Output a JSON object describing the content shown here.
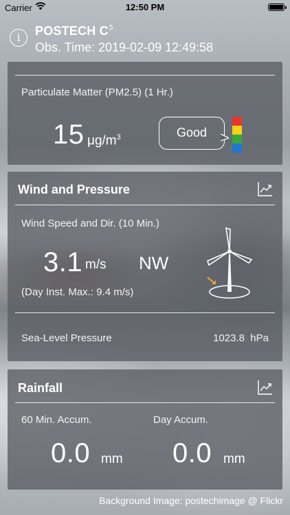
{
  "status_bar": {
    "carrier": "Carrier",
    "time": "12:50 PM"
  },
  "header": {
    "station": "POSTECH C",
    "station_sup": "5",
    "obs_time": "Obs. Time: 2019-02-09 12:49:58"
  },
  "air_quality": {
    "pm_label": "Particulate Matter (PM2.5) (1 Hr.)",
    "pm_value": "15",
    "pm_unit": "μg/m",
    "pm_unit_sup": "3",
    "grade": "Good",
    "scale_colors": [
      "#e8352c",
      "#f5d11a",
      "#3aa83a",
      "#1f77d0"
    ]
  },
  "wind": {
    "title": "Wind and Pressure",
    "speed_label": "Wind Speed and Dir. (10 Min.)",
    "speed_value": "3.1",
    "speed_unit": "m/s",
    "direction": "NW",
    "max_label": "(Day Inst. Max.: 9.4 m/s)",
    "pressure_label": "Sea-Level Pressure",
    "pressure_value": "1023.8",
    "pressure_unit": "hPa"
  },
  "rain": {
    "title": "Rainfall",
    "accum60_label": "60 Min. Accum.",
    "accum60_value": "0.0",
    "accum60_unit": "mm",
    "day_label": "Day Accum.",
    "day_value": "0.0",
    "day_unit": "mm"
  },
  "footer": {
    "credit": "Background Image: postechimage @ Flickr"
  },
  "colors": {
    "card_bg": "#5a5e64",
    "accent": "#ffffff",
    "arrow_accent": "#e8a43a"
  }
}
